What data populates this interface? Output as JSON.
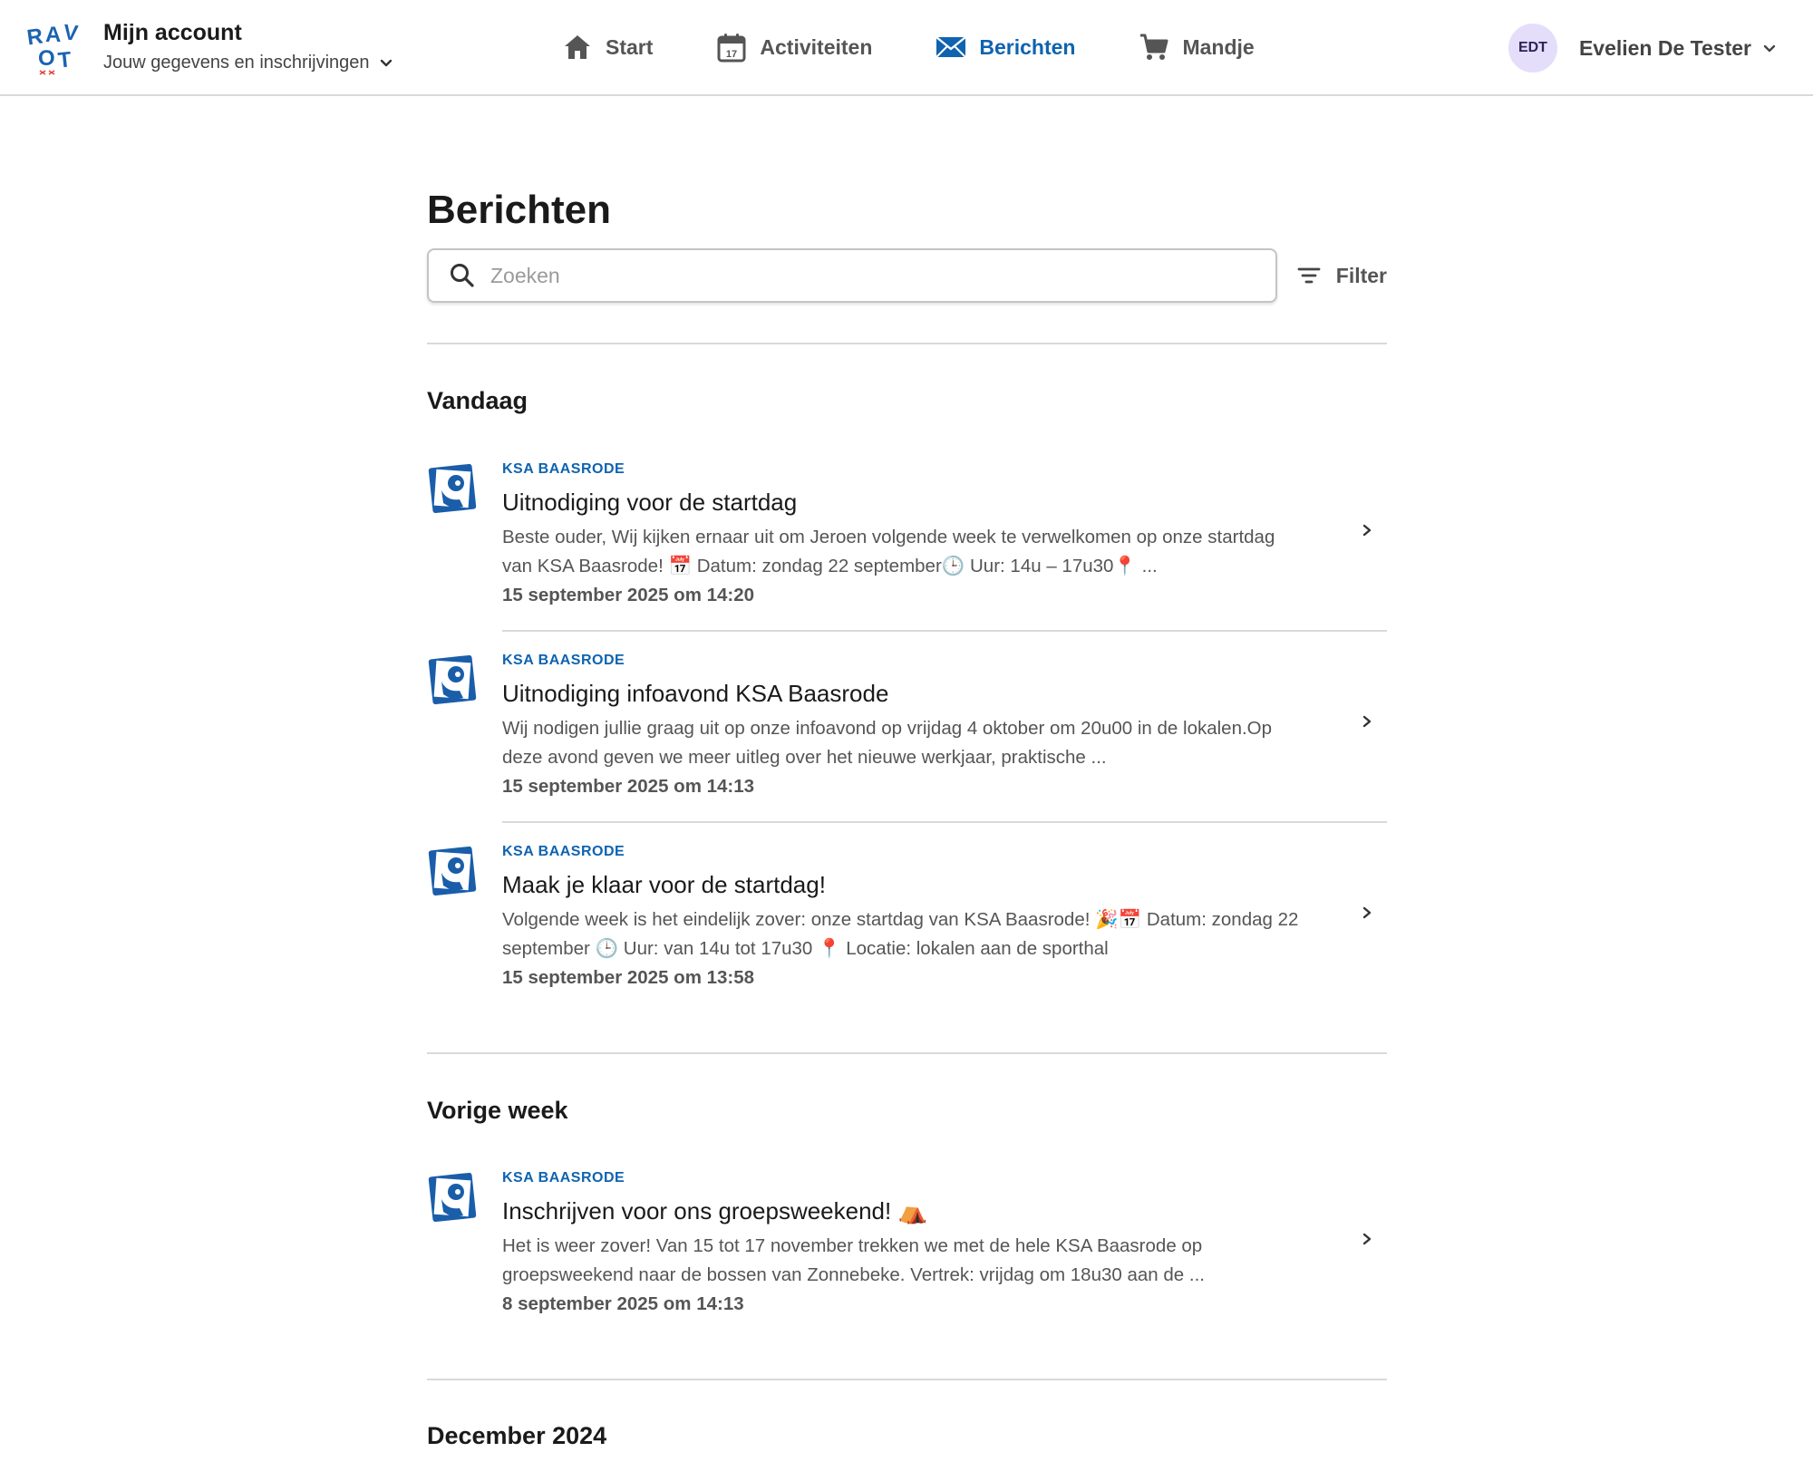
{
  "brand": {
    "logo_text_top": "RAV",
    "logo_text_bottom": "OT"
  },
  "account": {
    "title": "Mijn account",
    "subtitle": "Jouw gegevens en inschrijvingen"
  },
  "nav": {
    "items": [
      {
        "label": "Start",
        "icon": "home-icon",
        "active": false
      },
      {
        "label": "Activiteiten",
        "icon": "calendar-icon",
        "active": false
      },
      {
        "label": "Berichten",
        "icon": "mail-icon",
        "active": true
      },
      {
        "label": "Mandje",
        "icon": "cart-icon",
        "active": false
      }
    ]
  },
  "user": {
    "initials": "EDT",
    "name": "Evelien De Tester"
  },
  "page": {
    "title": "Berichten",
    "search_placeholder": "Zoeken",
    "filter_label": "Filter"
  },
  "sections": [
    {
      "title": "Vandaag",
      "messages": [
        {
          "org": "KSA BAASRODE",
          "title": "Uitnodiging voor de startdag",
          "text": "Beste ouder, Wij kijken ernaar uit om Jeroen volgende week te verwelkomen op onze startdag van KSA Baasrode! 📅 Datum: zondag 22 september🕒 Uur: 14u – 17u30📍 ...",
          "date": "15 september 2025 om 14:20"
        },
        {
          "org": "KSA BAASRODE",
          "title": "Uitnodiging infoavond KSA Baasrode",
          "text": "Wij nodigen jullie graag uit op onze infoavond op vrijdag 4 oktober om 20u00 in de lokalen.Op deze avond geven we meer uitleg over het nieuwe werkjaar, praktische ...",
          "date": "15 september 2025 om 14:13"
        },
        {
          "org": "KSA BAASRODE",
          "title": "Maak je klaar voor de startdag!",
          "text": "Volgende week is het eindelijk zover: onze startdag van KSA Baasrode! 🎉📅 Datum: zondag 22 september 🕒 Uur: van 14u tot 17u30 📍 Locatie: lokalen aan de sporthal",
          "date": "15 september 2025 om 13:58"
        }
      ]
    },
    {
      "title": "Vorige week",
      "messages": [
        {
          "org": "KSA BAASRODE",
          "title": "Inschrijven voor ons groepsweekend! ⛺",
          "text": "Het is weer zover! Van 15 tot 17 november trekken we met de hele KSA Baasrode op groepsweekend naar de bossen van Zonnebeke. Vertrek: vrijdag om 18u30 aan de ...",
          "date": "8 september 2025 om 14:13"
        }
      ]
    },
    {
      "title": "December 2024",
      "messages": []
    }
  ],
  "colors": {
    "accent": "#0f63b0",
    "text": "#1a1a1a",
    "muted": "#555555",
    "divider": "#d9d9d9",
    "avatar_bg": "#e4defb"
  }
}
